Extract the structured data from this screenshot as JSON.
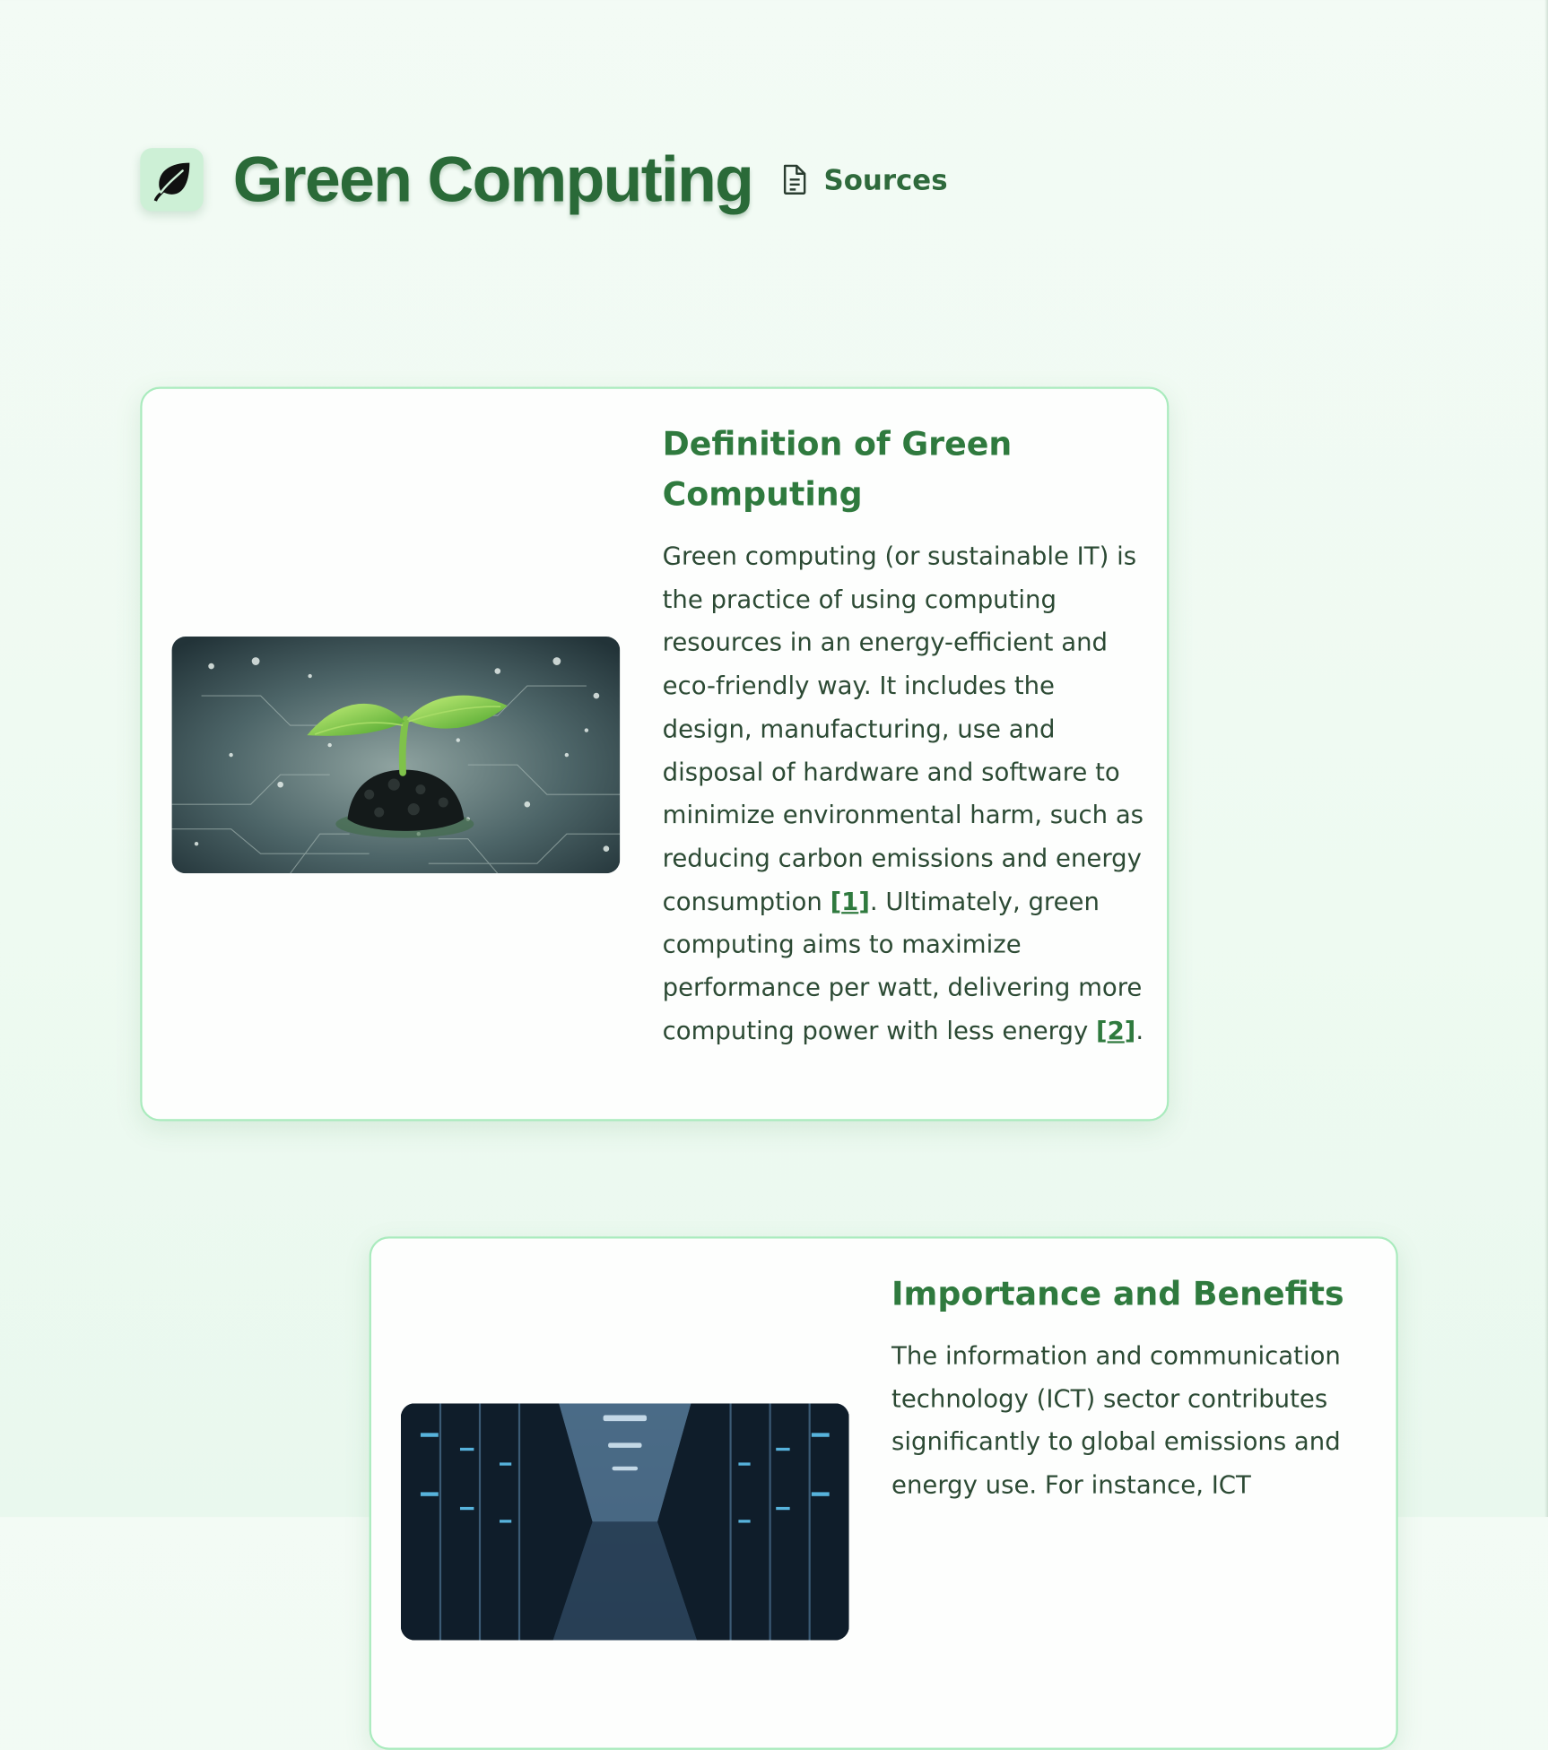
{
  "header": {
    "title": "Green Computing",
    "logo_icon": "leaf-icon",
    "sources_icon": "document-icon",
    "sources_label": "Sources"
  },
  "colors": {
    "accent": "#2f7a3e",
    "title": "#2a6a38",
    "card_border": "#a9ebbd",
    "logo_bg": "#cdf0d6",
    "page_bg": "#f1faf3"
  },
  "sections": [
    {
      "title": "Definition of Green Computing",
      "image_alt": "seedling-on-circuit-board",
      "body_1": "Green computing (or sustainable IT) is the practice of using computing resources in an energy-efficient and eco-friendly way. It includes the design, manufacturing, use and disposal of hardware and software to minimize environmental harm, such as reducing carbon emissions and energy consumption ",
      "cite_1": "1",
      "body_2": ". Ultimately, green computing aims to maximize performance per watt, delivering more computing power with less energy ",
      "cite_2": "2",
      "body_3": "."
    },
    {
      "title": "Importance and Benefits",
      "image_alt": "data-center-server-aisle",
      "body_1": "The information and communication technology (ICT) sector contributes significantly to global emissions and energy use. For instance, ICT"
    }
  ]
}
